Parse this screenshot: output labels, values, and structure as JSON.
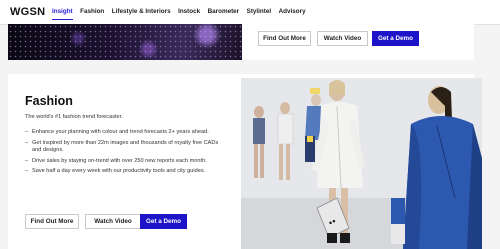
{
  "nav": {
    "logo": "WGSN",
    "items": [
      {
        "label": "Insight",
        "active": true
      },
      {
        "label": "Fashion",
        "active": false
      },
      {
        "label": "Lifestyle & Interiors",
        "active": false
      },
      {
        "label": "Instock",
        "active": false
      },
      {
        "label": "Barometer",
        "active": false
      },
      {
        "label": "Stylintel",
        "active": false
      },
      {
        "label": "Advisory",
        "active": false
      }
    ]
  },
  "card1": {
    "buttons": {
      "find_out_more": "Find Out More",
      "watch_video": "Watch Video",
      "get_demo": "Get a Demo"
    }
  },
  "card2": {
    "title": "Fashion",
    "subtitle": "The world's #1 fashion trend forecaster.",
    "bullets": [
      "Enhance your planning with colour and trend forecasts 2+ years ahead.",
      "Get inspired by more than 22m images and thousands of royalty free CADs and designs.",
      "Drive sales by staying on-trend with over 250 new reports each month.",
      "Save half a day every week with our productivity tools and city guides."
    ],
    "buttons": {
      "find_out_more": "Find Out More",
      "watch_video": "Watch Video",
      "get_demo": "Get a Demo"
    }
  },
  "colors": {
    "accent": "#1d13c9",
    "nav_active": "#2a22d8"
  }
}
